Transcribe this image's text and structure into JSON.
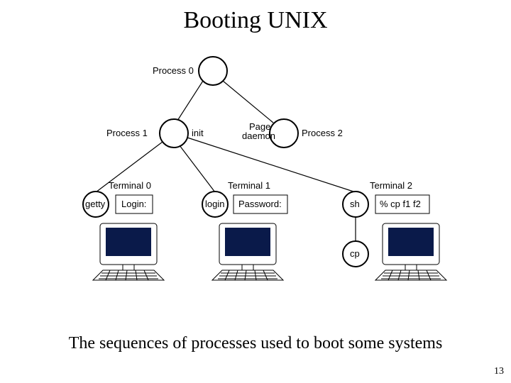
{
  "title": "Booting UNIX",
  "caption": "The sequences of processes used to boot some systems",
  "page_number": "13",
  "nodes": {
    "process0": "Process 0",
    "process1": "Process 1",
    "process2": "Process 2",
    "init": "init",
    "page_daemon1": "Page",
    "page_daemon2": "daemon",
    "terminal0": "Terminal 0",
    "terminal1": "Terminal 1",
    "terminal2": "Terminal 2",
    "getty": "getty",
    "login_prompt": "Login:",
    "login": "login",
    "password": "Password:",
    "sh": "sh",
    "cp_cmd": "% cp f1 f2",
    "cp": "cp"
  }
}
